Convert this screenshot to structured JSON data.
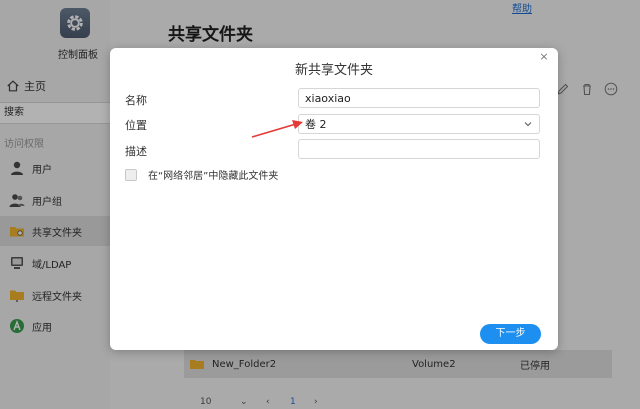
{
  "window": {
    "help_link": "帮助"
  },
  "sidebar": {
    "control_panel_label": "控制面板",
    "home_label": "主页",
    "search_placeholder": "搜索",
    "section_label": "访问权限",
    "items": [
      {
        "label": "用户",
        "icon": "user-icon"
      },
      {
        "label": "用户组",
        "icon": "group-icon"
      },
      {
        "label": "共享文件夹",
        "icon": "shared-folder-icon",
        "active": true
      },
      {
        "label": "域/LDAP",
        "icon": "domain-icon"
      },
      {
        "label": "远程文件夹",
        "icon": "remote-folder-icon"
      },
      {
        "label": "应用",
        "icon": "app-icon"
      }
    ]
  },
  "main": {
    "title": "共享文件夹",
    "row": {
      "name": "New_Folder2",
      "volume": "Volume2",
      "status": "已停用"
    },
    "pager": {
      "page_size": "10",
      "current_page": "1"
    }
  },
  "modal": {
    "title": "新共享文件夹",
    "name_label": "名称",
    "name_value": "xiaoxiao",
    "location_label": "位置",
    "location_value": "卷 2",
    "desc_label": "描述",
    "desc_value": "",
    "hide_label": "在“网络邻居”中隐藏此文件夹",
    "next_button": "下一步"
  },
  "colors": {
    "accent": "#1c8ff0",
    "annotation_arrow": "#e53935",
    "folder": "#f1b42f"
  }
}
